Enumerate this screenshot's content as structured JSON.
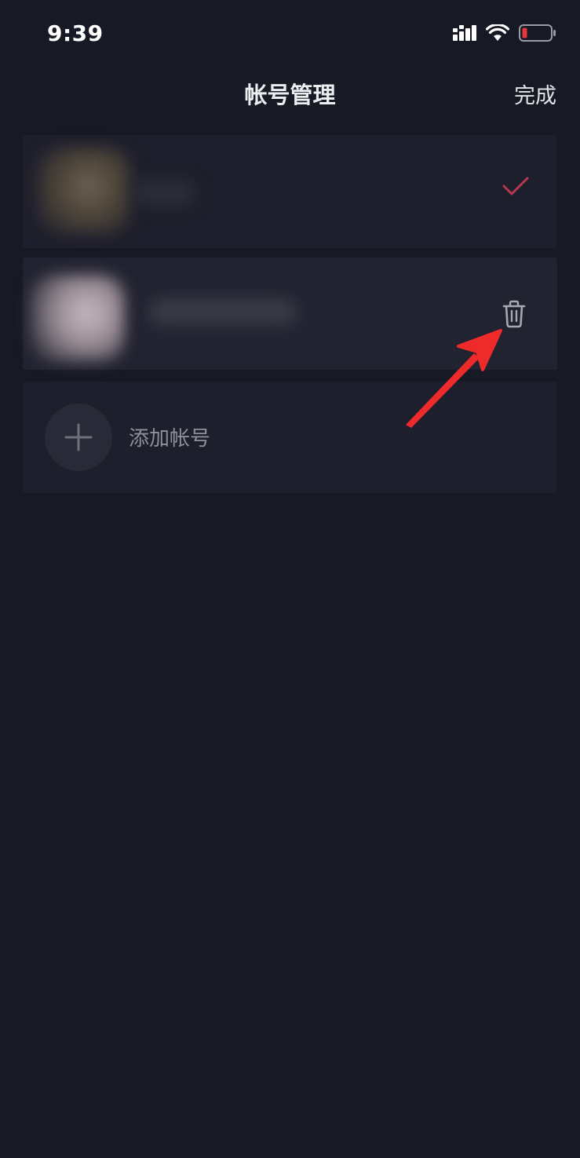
{
  "status_bar": {
    "time": "9:39",
    "icons": [
      "signal-icon",
      "wifi-icon",
      "battery-low-icon"
    ]
  },
  "header": {
    "title": "帐号管理",
    "done_label": "完成"
  },
  "accounts": [
    {
      "state": "current",
      "action_icon": "check-icon"
    },
    {
      "state": "removable",
      "action_icon": "trash-icon"
    }
  ],
  "add_account": {
    "label": "添加帐号",
    "icon": "plus-icon"
  },
  "colors": {
    "background": "#171924",
    "card": "#1e1f2c",
    "accent_check": "#b8364e",
    "annotation_arrow": "#ee2a2a"
  }
}
